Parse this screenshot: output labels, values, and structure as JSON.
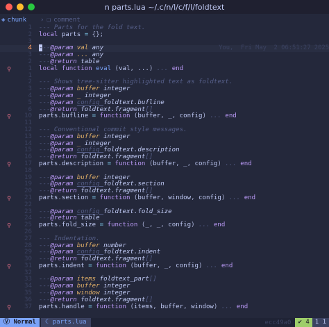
{
  "window": {
    "title": "n parts.lua ~/.c/n/l/c/f/l/foldtext",
    "traffic_lights": [
      "#ff5f57",
      "#febc2e",
      "#28c840"
    ]
  },
  "winbar": {
    "left_icon": "square-icon",
    "left_label": "chunk",
    "sep": "›",
    "symbol_icon": "symbol-icon",
    "context": "comment"
  },
  "editor": {
    "blame_text": "You,  Fri May  2 06:51:27 2025",
    "lines": [
      {
        "num": "1",
        "sign": "",
        "tokens": [
          {
            "t": "--- Parts for the fold text.",
            "c": "c"
          }
        ]
      },
      {
        "num": "2",
        "sign": "",
        "tokens": [
          {
            "t": "local ",
            "c": "kw2"
          },
          {
            "t": "parts",
            "c": "id"
          },
          {
            "t": " = ",
            "c": "op"
          },
          {
            "t": "{};",
            "c": "pu"
          }
        ]
      },
      {
        "num": "3",
        "sign": "",
        "tokens": []
      },
      {
        "num": "4",
        "sign": "",
        "current": true,
        "tokens": [
          {
            "t": "-",
            "c": "cur"
          },
          {
            "t": "--",
            "c": "c"
          },
          {
            "t": "@param ",
            "c": "ann"
          },
          {
            "t": "val ",
            "c": "pn"
          },
          {
            "t": "any",
            "c": "ty"
          }
        ]
      },
      {
        "num": "3",
        "sign": "",
        "tokens": [
          {
            "t": "---",
            "c": "c"
          },
          {
            "t": "@param ",
            "c": "ann"
          },
          {
            "t": "... ",
            "c": "pn"
          },
          {
            "t": "any",
            "c": "ty"
          }
        ]
      },
      {
        "num": "2",
        "sign": "",
        "tokens": [
          {
            "t": "---",
            "c": "c"
          },
          {
            "t": "@return ",
            "c": "ann"
          },
          {
            "t": "table",
            "c": "ty"
          }
        ]
      },
      {
        "num": "1",
        "sign": "ᕓ",
        "tokens": [
          {
            "t": "local ",
            "c": "kw2"
          },
          {
            "t": "function ",
            "c": "kw2"
          },
          {
            "t": "eval ",
            "c": "fn"
          },
          {
            "t": "(",
            "c": "pu"
          },
          {
            "t": "val",
            "c": "id"
          },
          {
            "t": ", ",
            "c": "pu"
          },
          {
            "t": "...",
            "c": "id"
          },
          {
            "t": ") ",
            "c": "pu"
          },
          {
            "t": "... ",
            "c": "c"
          },
          {
            "t": "end",
            "c": "kw2"
          }
        ]
      },
      {
        "num": "1",
        "sign": "",
        "tokens": []
      },
      {
        "num": "2",
        "sign": "",
        "tokens": [
          {
            "t": "--- Shows tree-sitter highlighted text as foldtext.",
            "c": "c"
          }
        ]
      },
      {
        "num": "3",
        "sign": "",
        "tokens": [
          {
            "t": "---",
            "c": "c"
          },
          {
            "t": "@param ",
            "c": "ann"
          },
          {
            "t": "buffer ",
            "c": "pn"
          },
          {
            "t": "integer",
            "c": "ty"
          }
        ]
      },
      {
        "num": "4",
        "sign": "",
        "tokens": [
          {
            "t": "---",
            "c": "c"
          },
          {
            "t": "@param ",
            "c": "ann"
          },
          {
            "t": "_ ",
            "c": "pn"
          },
          {
            "t": "integer",
            "c": "ty"
          }
        ]
      },
      {
        "num": "5",
        "sign": "",
        "tokens": [
          {
            "t": "---",
            "c": "c"
          },
          {
            "t": "@param ",
            "c": "ann"
          },
          {
            "t": "config ",
            "c": "ci"
          },
          {
            "t": "foldtext.bufline",
            "c": "ty"
          }
        ]
      },
      {
        "num": "6",
        "sign": "",
        "tokens": [
          {
            "t": "---",
            "c": "c"
          },
          {
            "t": "@return ",
            "c": "ann"
          },
          {
            "t": "foldtext.fragment",
            "c": "ty"
          },
          {
            "t": "[]",
            "c": "c"
          }
        ]
      },
      {
        "num": "10",
        "sign": "ᕓ",
        "tokens": [
          {
            "t": "parts",
            "c": "id"
          },
          {
            "t": ".",
            "c": "pu"
          },
          {
            "t": "bufline",
            "c": "id"
          },
          {
            "t": " = ",
            "c": "op"
          },
          {
            "t": "function ",
            "c": "kw2"
          },
          {
            "t": "(",
            "c": "pu"
          },
          {
            "t": "buffer",
            "c": "id"
          },
          {
            "t": ", ",
            "c": "pu"
          },
          {
            "t": "_",
            "c": "id"
          },
          {
            "t": ", ",
            "c": "pu"
          },
          {
            "t": "config",
            "c": "id"
          },
          {
            "t": ") ",
            "c": "pu"
          },
          {
            "t": "... ",
            "c": "c"
          },
          {
            "t": "end",
            "c": "kw2"
          }
        ]
      },
      {
        "num": "11",
        "sign": "",
        "tokens": []
      },
      {
        "num": "12",
        "sign": "",
        "tokens": [
          {
            "t": "--- Conventional commit style messages.",
            "c": "c"
          }
        ]
      },
      {
        "num": "13",
        "sign": "",
        "tokens": [
          {
            "t": "---",
            "c": "c"
          },
          {
            "t": "@param ",
            "c": "ann"
          },
          {
            "t": "buffer ",
            "c": "pn"
          },
          {
            "t": "integer",
            "c": "ty"
          }
        ]
      },
      {
        "num": "14",
        "sign": "",
        "tokens": [
          {
            "t": "---",
            "c": "c"
          },
          {
            "t": "@param ",
            "c": "ann"
          },
          {
            "t": "_ ",
            "c": "pn"
          },
          {
            "t": "integer",
            "c": "ty"
          }
        ]
      },
      {
        "num": "15",
        "sign": "",
        "tokens": [
          {
            "t": "---",
            "c": "c"
          },
          {
            "t": "@param ",
            "c": "ann"
          },
          {
            "t": "config ",
            "c": "ci"
          },
          {
            "t": "foldtext.description",
            "c": "ty"
          }
        ]
      },
      {
        "num": "16",
        "sign": "",
        "tokens": [
          {
            "t": "---",
            "c": "c"
          },
          {
            "t": "@return ",
            "c": "ann"
          },
          {
            "t": "foldtext.fragment",
            "c": "ty"
          },
          {
            "t": "[]",
            "c": "c"
          }
        ]
      },
      {
        "num": "17",
        "sign": "ᕓ",
        "tokens": [
          {
            "t": "parts",
            "c": "id"
          },
          {
            "t": ".",
            "c": "pu"
          },
          {
            "t": "description",
            "c": "id"
          },
          {
            "t": " = ",
            "c": "op"
          },
          {
            "t": "function ",
            "c": "kw2"
          },
          {
            "t": "(",
            "c": "pu"
          },
          {
            "t": "buffer",
            "c": "id"
          },
          {
            "t": ", ",
            "c": "pu"
          },
          {
            "t": "_",
            "c": "id"
          },
          {
            "t": ", ",
            "c": "pu"
          },
          {
            "t": "config",
            "c": "id"
          },
          {
            "t": ") ",
            "c": "pu"
          },
          {
            "t": "... ",
            "c": "c"
          },
          {
            "t": "end",
            "c": "kw2"
          }
        ]
      },
      {
        "num": "18",
        "sign": "",
        "tokens": []
      },
      {
        "num": "19",
        "sign": "",
        "tokens": [
          {
            "t": "---",
            "c": "c"
          },
          {
            "t": "@param ",
            "c": "ann"
          },
          {
            "t": "buffer ",
            "c": "pn"
          },
          {
            "t": "integer",
            "c": "ty"
          }
        ]
      },
      {
        "num": "19",
        "sign": "",
        "tokens": [
          {
            "t": "---",
            "c": "c"
          },
          {
            "t": "@param ",
            "c": "ann"
          },
          {
            "t": "config ",
            "c": "ci"
          },
          {
            "t": "foldtext.section",
            "c": "ty"
          }
        ]
      },
      {
        "num": "20",
        "sign": "",
        "tokens": [
          {
            "t": "---",
            "c": "c"
          },
          {
            "t": "@return ",
            "c": "ann"
          },
          {
            "t": "foldtext.fragment",
            "c": "ty"
          },
          {
            "t": "[]",
            "c": "c"
          }
        ]
      },
      {
        "num": "21",
        "sign": "ᕓ",
        "tokens": [
          {
            "t": "parts",
            "c": "id"
          },
          {
            "t": ".",
            "c": "pu"
          },
          {
            "t": "section",
            "c": "id"
          },
          {
            "t": " = ",
            "c": "op"
          },
          {
            "t": "function ",
            "c": "kw2"
          },
          {
            "t": "(",
            "c": "pu"
          },
          {
            "t": "buffer",
            "c": "id"
          },
          {
            "t": ", ",
            "c": "pu"
          },
          {
            "t": "window",
            "c": "id"
          },
          {
            "t": ", ",
            "c": "pu"
          },
          {
            "t": "config",
            "c": "id"
          },
          {
            "t": ") ",
            "c": "pu"
          },
          {
            "t": "... ",
            "c": "c"
          },
          {
            "t": "end",
            "c": "kw2"
          }
        ]
      },
      {
        "num": "22",
        "sign": "",
        "tokens": []
      },
      {
        "num": "23",
        "sign": "",
        "tokens": [
          {
            "t": "---",
            "c": "c"
          },
          {
            "t": "@param ",
            "c": "ann"
          },
          {
            "t": "config ",
            "c": "ci"
          },
          {
            "t": "foldtext.fold_size",
            "c": "ty"
          }
        ]
      },
      {
        "num": "24",
        "sign": "",
        "tokens": [
          {
            "t": "---",
            "c": "c"
          },
          {
            "t": "@return ",
            "c": "ann"
          },
          {
            "t": "table",
            "c": "ty"
          }
        ]
      },
      {
        "num": "25",
        "sign": "ᕓ",
        "tokens": [
          {
            "t": "parts",
            "c": "id"
          },
          {
            "t": ".",
            "c": "pu"
          },
          {
            "t": "fold_size",
            "c": "id"
          },
          {
            "t": " = ",
            "c": "op"
          },
          {
            "t": "function ",
            "c": "kw2"
          },
          {
            "t": "(",
            "c": "pu"
          },
          {
            "t": "_",
            "c": "id"
          },
          {
            "t": ", ",
            "c": "pu"
          },
          {
            "t": "_",
            "c": "id"
          },
          {
            "t": ", ",
            "c": "pu"
          },
          {
            "t": "config",
            "c": "id"
          },
          {
            "t": ") ",
            "c": "pu"
          },
          {
            "t": "... ",
            "c": "c"
          },
          {
            "t": "end",
            "c": "kw2"
          }
        ]
      },
      {
        "num": "26",
        "sign": "",
        "tokens": []
      },
      {
        "num": "27",
        "sign": "",
        "tokens": [
          {
            "t": "--- Indentation.",
            "c": "c"
          }
        ]
      },
      {
        "num": "28",
        "sign": "",
        "tokens": [
          {
            "t": "---",
            "c": "c"
          },
          {
            "t": "@param ",
            "c": "ann"
          },
          {
            "t": "buffer ",
            "c": "pn"
          },
          {
            "t": "number",
            "c": "ty"
          }
        ]
      },
      {
        "num": "29",
        "sign": "",
        "tokens": [
          {
            "t": "---",
            "c": "c"
          },
          {
            "t": "@param ",
            "c": "ann"
          },
          {
            "t": "config ",
            "c": "ci"
          },
          {
            "t": "foldtext.indent",
            "c": "ty"
          }
        ]
      },
      {
        "num": "30",
        "sign": "",
        "tokens": [
          {
            "t": "---",
            "c": "c"
          },
          {
            "t": "@return ",
            "c": "ann"
          },
          {
            "t": "foldtext.fragment",
            "c": "ty"
          },
          {
            "t": "[]",
            "c": "c"
          }
        ]
      },
      {
        "num": "31",
        "sign": "ᕓ",
        "tokens": [
          {
            "t": "parts",
            "c": "id"
          },
          {
            "t": ".",
            "c": "pu"
          },
          {
            "t": "indent",
            "c": "id"
          },
          {
            "t": " = ",
            "c": "op"
          },
          {
            "t": "function ",
            "c": "kw2"
          },
          {
            "t": "(",
            "c": "pu"
          },
          {
            "t": "buffer",
            "c": "id"
          },
          {
            "t": ", ",
            "c": "pu"
          },
          {
            "t": "_",
            "c": "id"
          },
          {
            "t": ", ",
            "c": "pu"
          },
          {
            "t": "config",
            "c": "id"
          },
          {
            "t": ") ",
            "c": "pu"
          },
          {
            "t": "... ",
            "c": "c"
          },
          {
            "t": "end",
            "c": "kw2"
          }
        ]
      },
      {
        "num": "32",
        "sign": "",
        "tokens": []
      },
      {
        "num": "33",
        "sign": "",
        "tokens": [
          {
            "t": "---",
            "c": "c"
          },
          {
            "t": "@param ",
            "c": "ann"
          },
          {
            "t": "items ",
            "c": "pn"
          },
          {
            "t": "foldtext_part",
            "c": "ty"
          },
          {
            "t": "[]",
            "c": "c"
          }
        ]
      },
      {
        "num": "34",
        "sign": "",
        "tokens": [
          {
            "t": "---",
            "c": "c"
          },
          {
            "t": "@param ",
            "c": "ann"
          },
          {
            "t": "buffer ",
            "c": "pn"
          },
          {
            "t": "integer",
            "c": "ty"
          }
        ]
      },
      {
        "num": "35",
        "sign": "",
        "tokens": [
          {
            "t": "---",
            "c": "c"
          },
          {
            "t": "@param ",
            "c": "ann"
          },
          {
            "t": "window ",
            "c": "pn"
          },
          {
            "t": "integer",
            "c": "ty"
          }
        ]
      },
      {
        "num": "36",
        "sign": "",
        "tokens": [
          {
            "t": "---",
            "c": "c"
          },
          {
            "t": "@return ",
            "c": "ann"
          },
          {
            "t": "foldtext.fragment",
            "c": "ty"
          },
          {
            "t": "[]",
            "c": "c"
          }
        ]
      },
      {
        "num": "37",
        "sign": "ᕓ",
        "tokens": [
          {
            "t": "parts",
            "c": "id"
          },
          {
            "t": ".",
            "c": "pu"
          },
          {
            "t": "handle",
            "c": "id"
          },
          {
            "t": " = ",
            "c": "op"
          },
          {
            "t": "function ",
            "c": "kw2"
          },
          {
            "t": "(",
            "c": "pu"
          },
          {
            "t": "items",
            "c": "id"
          },
          {
            "t": ", ",
            "c": "pu"
          },
          {
            "t": "buffer",
            "c": "id"
          },
          {
            "t": ", ",
            "c": "pu"
          },
          {
            "t": "window",
            "c": "id"
          },
          {
            "t": ") ",
            "c": "pu"
          },
          {
            "t": "... ",
            "c": "c"
          },
          {
            "t": "end",
            "c": "kw2"
          }
        ]
      }
    ]
  },
  "statusbar": {
    "mode": "Normal",
    "mode_icon": "vim-icon",
    "file_icon": "file-icon",
    "file": "parts.lua",
    "branch": "ecc49a0",
    "diag_icon": "check-icon",
    "diag_a": "4",
    "diag_b": "1 1"
  }
}
